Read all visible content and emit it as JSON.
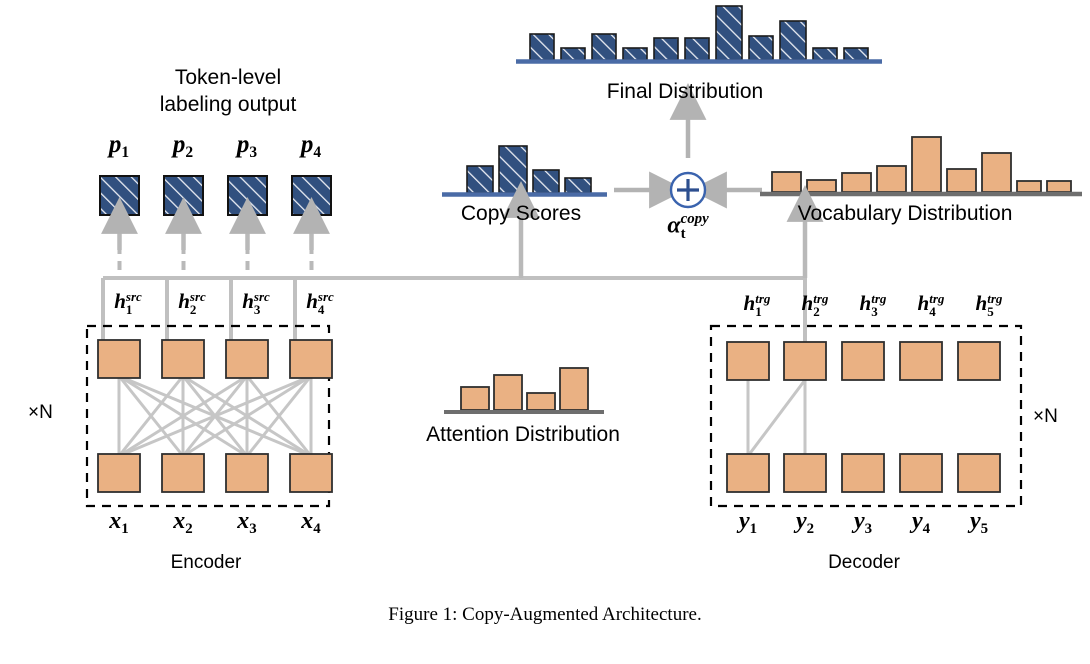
{
  "figure": {
    "caption": "Figure 1: Copy-Augmented Architecture.",
    "title": "Copy-Augmented Architecture"
  },
  "colors": {
    "hatch_blue": "#31507f",
    "hatch_blue_dark": "#2b4670",
    "orange": "#eab183",
    "orange_stroke": "#3a3a3a",
    "arrow_gray": "#b3b3b3",
    "line_gray": "#c0c0c0",
    "axis_gray": "#6e6e6e",
    "axis_blue": "#3f5fa0",
    "circle_blue": "#3a63ae",
    "dashed_box": "#000000",
    "background": "#ffffff"
  },
  "labels": {
    "token_level_line1": "Token-level",
    "token_level_line2": "labeling output",
    "final_distribution": "Final Distribution",
    "copy_scores": "Copy Scores",
    "vocabulary_distribution": "Vocabulary Distribution",
    "attention_distribution": "Attention Distribution",
    "encoder": "Encoder",
    "decoder": "Decoder",
    "repeat_encoder": "×N",
    "repeat_decoder": "×N",
    "plus_symbol": "+",
    "alpha_base": "α",
    "alpha_sup": "copy",
    "alpha_sub": "t"
  },
  "token_outputs": {
    "items": [
      {
        "base": "p",
        "sub": "1"
      },
      {
        "base": "p",
        "sub": "2"
      },
      {
        "base": "p",
        "sub": "3"
      },
      {
        "base": "p",
        "sub": "4"
      }
    ]
  },
  "encoder": {
    "hidden_labels": [
      {
        "base": "h",
        "sup": "src",
        "sub": "1"
      },
      {
        "base": "h",
        "sup": "src",
        "sub": "2"
      },
      {
        "base": "h",
        "sup": "src",
        "sub": "3"
      },
      {
        "base": "h",
        "sup": "src",
        "sub": "4"
      }
    ],
    "input_labels": [
      {
        "base": "x",
        "sub": "1"
      },
      {
        "base": "x",
        "sub": "2"
      },
      {
        "base": "x",
        "sub": "3"
      },
      {
        "base": "x",
        "sub": "4"
      }
    ],
    "rows": 2,
    "columns": 4,
    "fully_connected": true
  },
  "decoder": {
    "hidden_labels": [
      {
        "base": "h",
        "sup": "trg",
        "sub": "1"
      },
      {
        "base": "h",
        "sup": "trg",
        "sub": "2"
      },
      {
        "base": "h",
        "sup": "trg",
        "sub": "3"
      },
      {
        "base": "h",
        "sup": "trg",
        "sub": "4"
      },
      {
        "base": "h",
        "sup": "trg",
        "sub": "5"
      }
    ],
    "input_labels": [
      {
        "base": "y",
        "sub": "1"
      },
      {
        "base": "y",
        "sub": "2"
      },
      {
        "base": "y",
        "sub": "3"
      },
      {
        "base": "y",
        "sub": "4"
      },
      {
        "base": "y",
        "sub": "5"
      }
    ],
    "rows": 2,
    "columns": 5,
    "masked_connections": true
  },
  "chart_data": [
    {
      "type": "bar",
      "name": "final_distribution",
      "title": "Final Distribution",
      "style": "hatched-blue",
      "categories": [
        "1",
        "2",
        "3",
        "4",
        "5",
        "6",
        "7",
        "8",
        "9",
        "10",
        "11"
      ],
      "values": [
        24,
        11,
        24,
        11,
        20,
        20,
        50,
        22,
        36,
        11,
        11
      ],
      "ylim": [
        0,
        55
      ],
      "xlabel": "",
      "ylabel": "",
      "grid": false,
      "legend": "none"
    },
    {
      "type": "bar",
      "name": "copy_scores",
      "title": "Copy Scores",
      "style": "hatched-blue",
      "categories": [
        "1",
        "2",
        "3",
        "4"
      ],
      "values": [
        26,
        46,
        22,
        14
      ],
      "ylim": [
        0,
        50
      ],
      "xlabel": "",
      "ylabel": "",
      "grid": false,
      "legend": "none"
    },
    {
      "type": "bar",
      "name": "vocabulary_distribution",
      "title": "Vocabulary Distribution",
      "style": "solid-orange",
      "categories": [
        "1",
        "2",
        "3",
        "4",
        "5",
        "6",
        "7",
        "8",
        "9"
      ],
      "values": [
        17,
        10,
        16,
        22,
        47,
        19,
        33,
        9,
        9
      ],
      "ylim": [
        0,
        50
      ],
      "xlabel": "",
      "ylabel": "",
      "grid": false,
      "legend": "none"
    },
    {
      "type": "bar",
      "name": "attention_distribution",
      "title": "Attention Distribution",
      "style": "solid-orange",
      "categories": [
        "1",
        "2",
        "3",
        "4"
      ],
      "values": [
        20,
        29,
        14,
        36
      ],
      "ylim": [
        0,
        40
      ],
      "xlabel": "",
      "ylabel": "",
      "grid": false,
      "legend": "none"
    }
  ],
  "flow": {
    "combine_operation": "+",
    "edges": [
      {
        "from": "copy_scores",
        "to": "combine"
      },
      {
        "from": "vocabulary_distribution",
        "to": "combine"
      },
      {
        "from": "combine",
        "to": "final_distribution"
      },
      {
        "from": "encoder_hidden",
        "to": "copy_scores"
      },
      {
        "from": "decoder_hidden",
        "to": "vocabulary_distribution"
      },
      {
        "from": "encoder_hidden",
        "to": "token_outputs"
      }
    ]
  }
}
